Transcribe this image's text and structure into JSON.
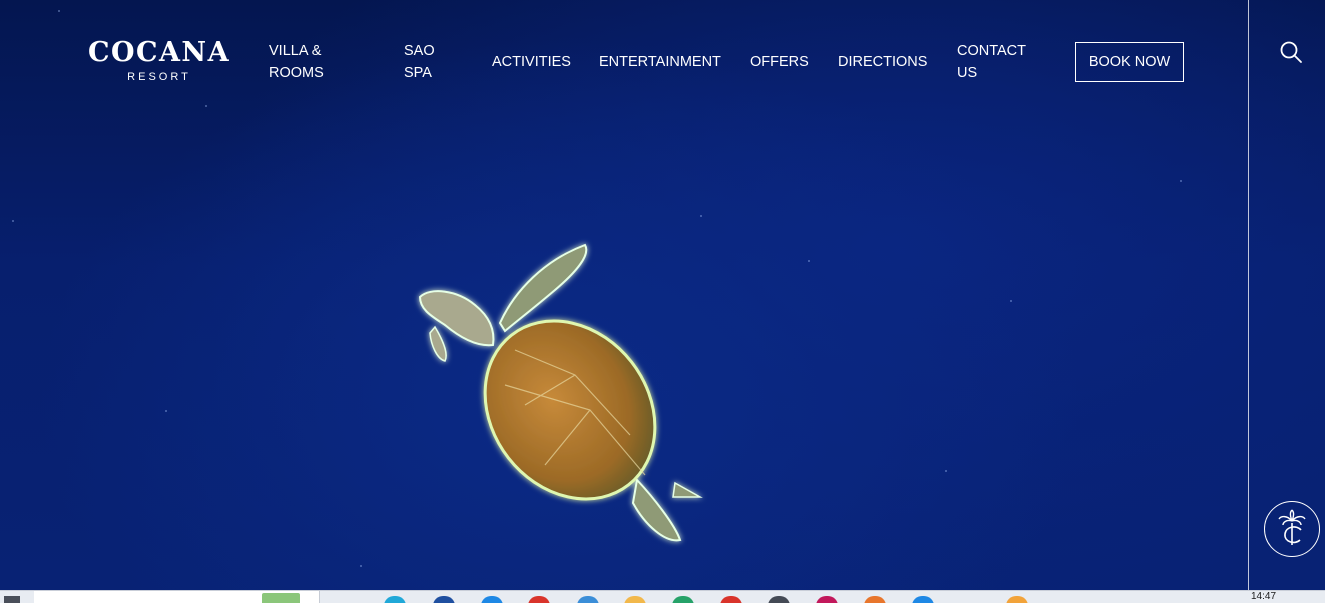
{
  "brand": {
    "name": "COCANA",
    "sub": "RESORT"
  },
  "nav": {
    "villa_line1": "VILLA &",
    "villa_line2": "ROOMS",
    "spa_line1": "SAO",
    "spa_line2": "SPA",
    "activities": "ACTIVITIES",
    "entertainment": "ENTERTAINMENT",
    "offers": "OFFERS",
    "directions": "DIRECTIONS",
    "contact_line1": "CONTACT",
    "contact_line2": "US",
    "book_now": "BOOK NOW"
  },
  "icons": {
    "search": "search-icon",
    "emblem": "palm-emblem-icon"
  },
  "colors": {
    "ocean": "#061a5c",
    "text": "#ffffff"
  },
  "taskbar": {
    "clock": "14:47"
  }
}
